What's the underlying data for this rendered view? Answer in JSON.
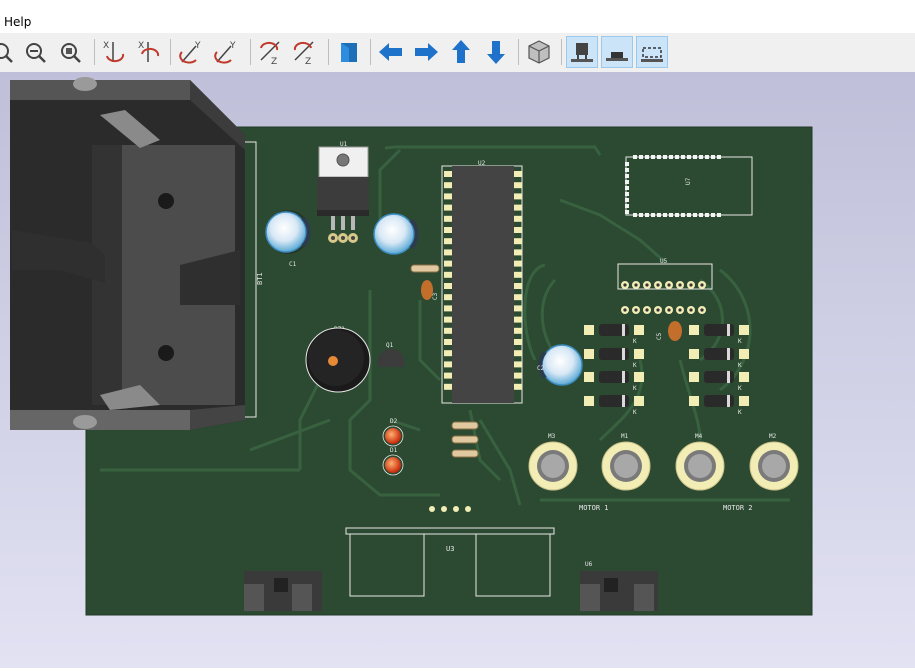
{
  "menu": {
    "help_label": "Help"
  },
  "toolbar": {
    "buttons": [
      {
        "name": "zoom-in-icon",
        "active": false
      },
      {
        "name": "zoom-out-icon",
        "active": false
      },
      {
        "name": "zoom-fit-icon",
        "active": false
      },
      {
        "name": "rotate-x-cw-icon",
        "active": false
      },
      {
        "name": "rotate-x-ccw-icon",
        "active": false
      },
      {
        "name": "rotate-y-cw-icon",
        "active": false
      },
      {
        "name": "rotate-y-ccw-icon",
        "active": false
      },
      {
        "name": "rotate-z-cw-icon",
        "active": false
      },
      {
        "name": "rotate-z-ccw-icon",
        "active": false
      },
      {
        "name": "flip-board-icon",
        "active": false
      },
      {
        "name": "pan-left-icon",
        "active": false
      },
      {
        "name": "pan-right-icon",
        "active": false
      },
      {
        "name": "pan-up-icon",
        "active": false
      },
      {
        "name": "pan-down-icon",
        "active": false
      },
      {
        "name": "ortho-view-icon",
        "active": false
      },
      {
        "name": "show-tht-icon",
        "active": true
      },
      {
        "name": "show-smd-icon",
        "active": true
      },
      {
        "name": "show-virtual-icon",
        "active": true
      }
    ]
  },
  "board": {
    "refs": {
      "bt1": "BT1",
      "u1": "U1",
      "u2": "U2",
      "u3": "U3",
      "u5": "U5",
      "u6": "U6",
      "u7": "U7",
      "c1": "C1",
      "c2": "C2",
      "c3": "C3",
      "c5": "C5",
      "bz1": "BZ1",
      "q1": "Q1",
      "d1": "D1",
      "d2": "D2",
      "m1": "M1",
      "m2": "M2",
      "m3": "M3",
      "m4": "M4"
    },
    "labels": {
      "motor1": "MOTOR 1",
      "motor2": "MOTOR 2",
      "k": "K"
    },
    "colors": {
      "soldermask": "#2b4a31",
      "silkscreen": "#e8e8e8",
      "pad": "#f2ecb5",
      "background_top": "#c2c2dc",
      "background_bottom": "#e0e0f2"
    }
  }
}
